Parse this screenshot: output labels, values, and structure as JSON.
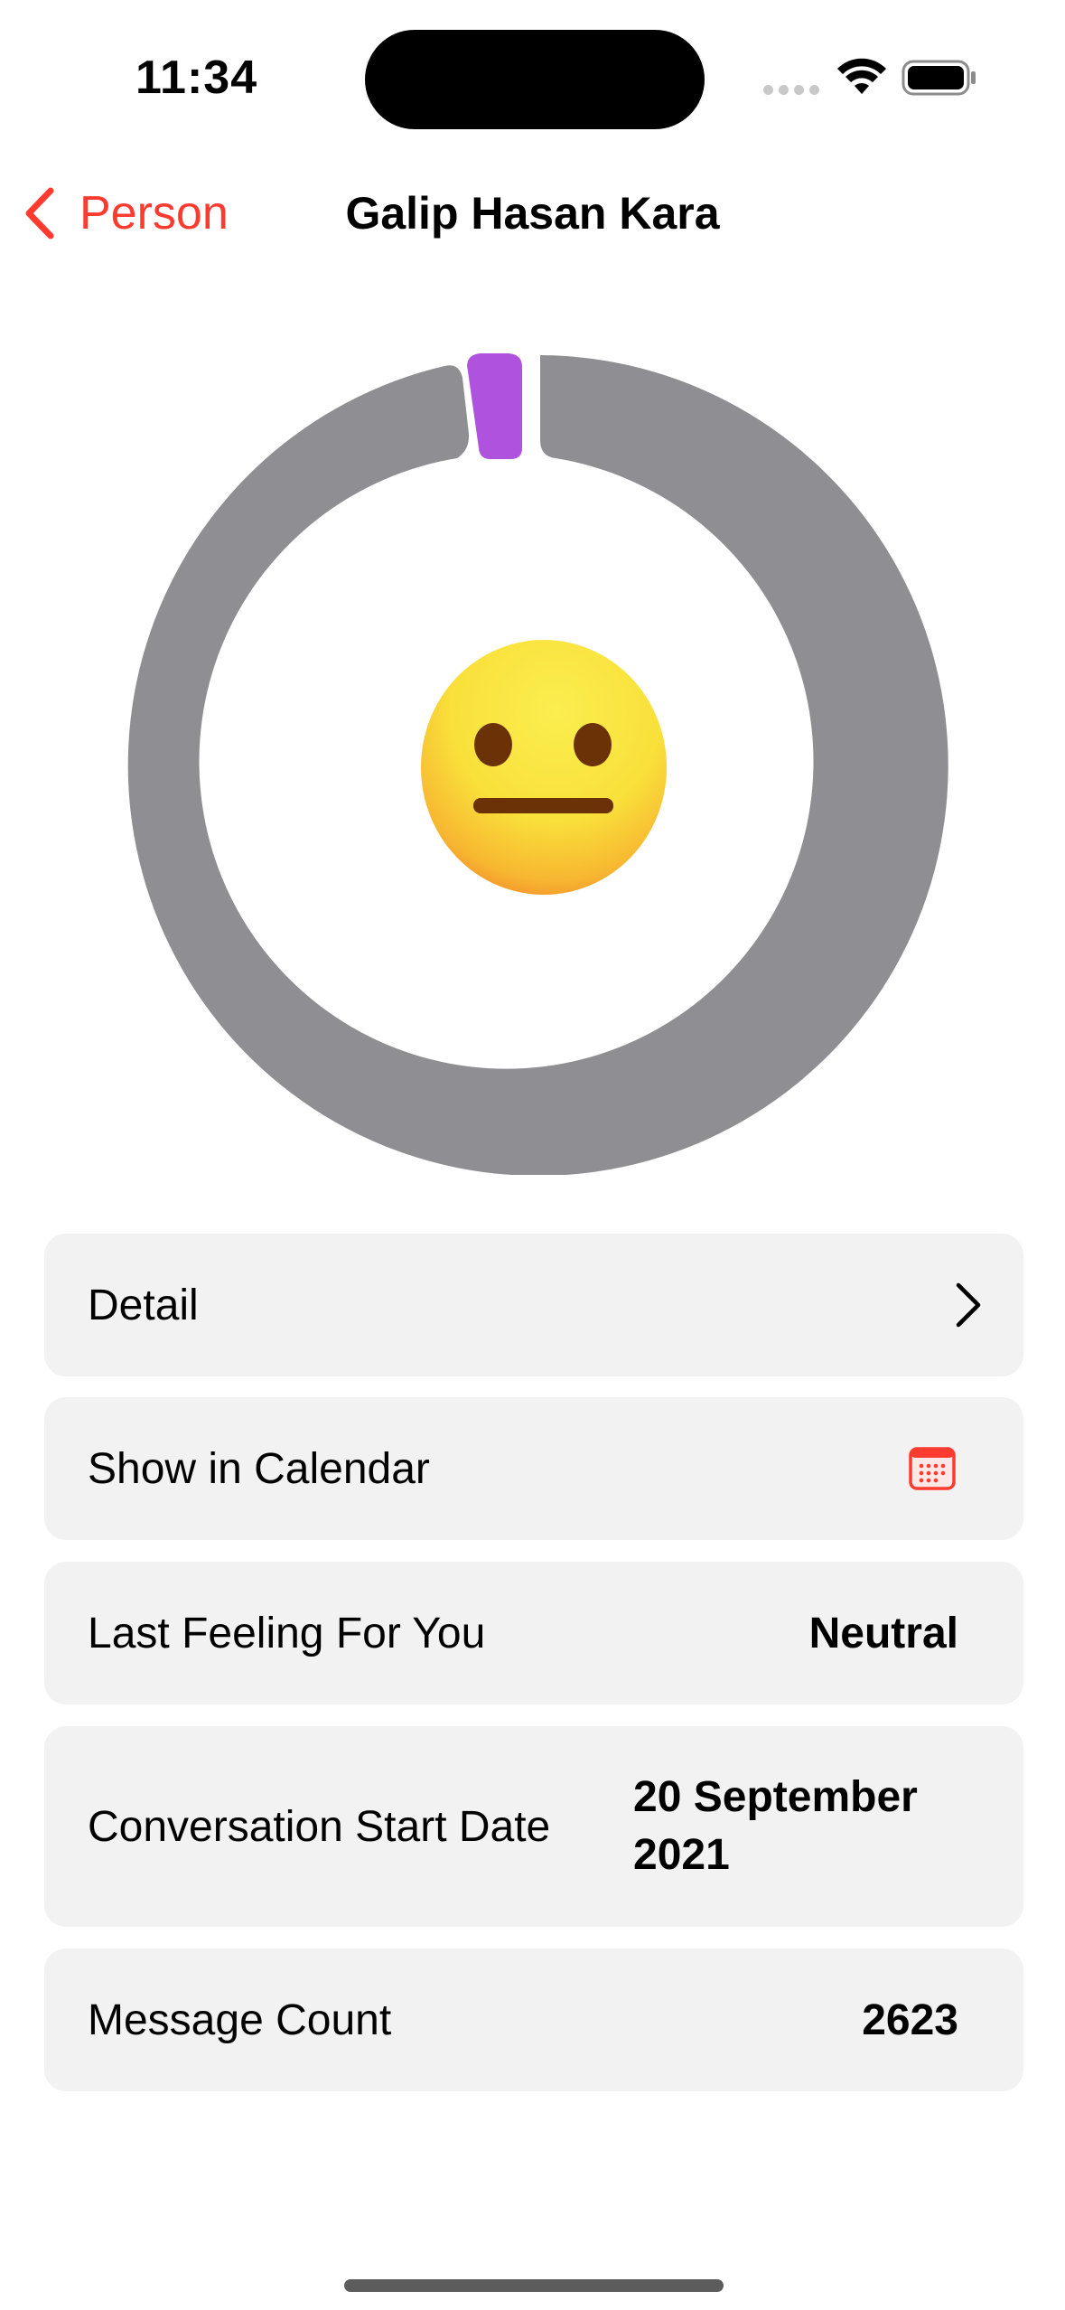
{
  "status_bar": {
    "time": "11:34"
  },
  "nav": {
    "back_label": "Person",
    "title": "Galip Hasan Kara"
  },
  "ring": {
    "emoji": "neutral-face",
    "segments": [
      {
        "color": "#8e8e93",
        "label": "grey"
      },
      {
        "color": "#af52de",
        "label": "purple"
      }
    ]
  },
  "rows": {
    "detail": {
      "label": "Detail"
    },
    "calendar": {
      "label": "Show in Calendar"
    },
    "feeling": {
      "label": "Last Feeling For You",
      "value": "Neutral"
    },
    "start": {
      "label": "Conversation Start Date",
      "value": "20 September 2021"
    },
    "count": {
      "label": "Message Count",
      "value": "2623"
    }
  },
  "colors": {
    "accent": "#ff3b30",
    "row_bg": "#f2f2f2",
    "ring_grey": "#8e8e93",
    "ring_purple": "#af52de"
  }
}
